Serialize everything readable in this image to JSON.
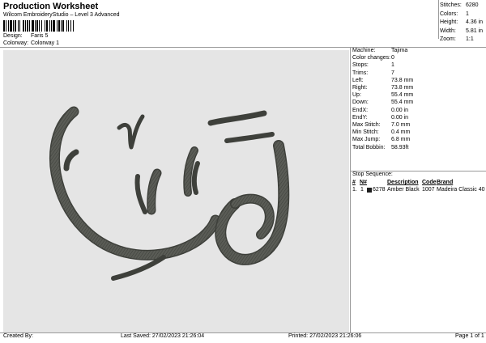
{
  "header": {
    "title": "Production Worksheet",
    "subtitle": "Wilcom EmbroideryStudio – Level 3 Advanced"
  },
  "design_info": {
    "design_label": "Design:",
    "design_value": "Faris 5",
    "colorway_label": "Colorway:",
    "colorway_value": "Colorway 1"
  },
  "stats": [
    {
      "label": "Stitches:",
      "value": "6280"
    },
    {
      "label": "Colors:",
      "value": "1"
    },
    {
      "label": "Height:",
      "value": "4.36 in"
    },
    {
      "label": "Width:",
      "value": "5.81 in"
    },
    {
      "label": "Zoom:",
      "value": "1:1"
    }
  ],
  "machine_info": [
    {
      "label": "Machine:",
      "value": "Tajima"
    },
    {
      "label": "Color changes:",
      "value": "0"
    },
    {
      "label": "Stops:",
      "value": "1"
    },
    {
      "label": "Trims:",
      "value": "7"
    },
    {
      "label": "Left:",
      "value": "73.8 mm"
    },
    {
      "label": "Right:",
      "value": "73.8 mm"
    },
    {
      "label": "Up:",
      "value": "55.4 mm"
    },
    {
      "label": "Down:",
      "value": "55.4 mm"
    },
    {
      "label": "EndX:",
      "value": "0.00 in"
    },
    {
      "label": "EndY:",
      "value": "0.00 in"
    },
    {
      "label": "Max Stitch:",
      "value": "7.0 mm"
    },
    {
      "label": "Min Stitch:",
      "value": "0.4 mm"
    },
    {
      "label": "Max Jump:",
      "value": "6.8 mm"
    },
    {
      "label": "Total Bobbin:",
      "value": "58.93ft"
    }
  ],
  "stop_sequence": {
    "label": "Stop Sequence:",
    "columns": [
      "#",
      "N#",
      "",
      "Description",
      "Code",
      "Brand"
    ],
    "rows": [
      {
        "num": "1.",
        "n": "1",
        "stitches": "6278",
        "description": "Amber Black",
        "code": "1007",
        "brand": "Madeira Classic 40",
        "color": "#1e1e1e"
      }
    ]
  },
  "footer": {
    "created_by": "Created By:",
    "last_saved": "Last Saved: 27/02/2023 21:26:04",
    "printed": "Printed: 27/02/2023 21:26:06",
    "page": "Page 1 of 1"
  },
  "colors": {
    "design_background": "#e5e5e5",
    "thread": "#5a5c56"
  }
}
